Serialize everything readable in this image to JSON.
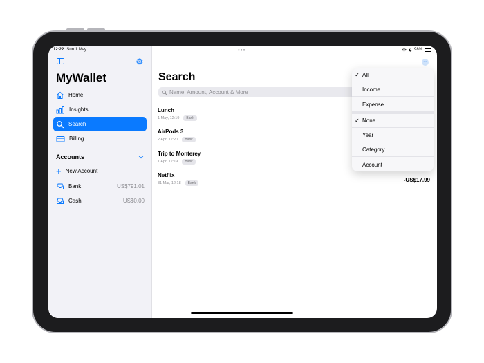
{
  "status": {
    "time": "12:22",
    "date": "Sun 1 May",
    "battery": "98%"
  },
  "multitask": "•••",
  "sidebar": {
    "app_title": "MyWallet",
    "nav": [
      {
        "label": "Home",
        "icon": "house-icon"
      },
      {
        "label": "Insights",
        "icon": "bar-chart-icon"
      },
      {
        "label": "Search",
        "icon": "search-icon",
        "active": true
      },
      {
        "label": "Billing",
        "icon": "credit-card-icon"
      }
    ],
    "accounts_header": "Accounts",
    "new_account_label": "New Account",
    "accounts": [
      {
        "name": "Bank",
        "balance": "US$791.01",
        "icon": "tray-icon"
      },
      {
        "name": "Cash",
        "balance": "US$0.00",
        "icon": "tray-icon"
      }
    ]
  },
  "main": {
    "title": "Search",
    "search_placeholder": "Name, Amount, Account & More",
    "transactions": [
      {
        "name": "Lunch",
        "date": "1 May, 12:19",
        "account": "Bank"
      },
      {
        "name": "AirPods 3",
        "date": "2 Apr, 12:20",
        "account": "Bank"
      },
      {
        "name": "Trip to Monterey",
        "date": "1 Apr, 12:19",
        "account": "Bank"
      },
      {
        "name": "Netflix",
        "date": "31 Mar, 12:18",
        "account": "Bank"
      }
    ],
    "visible_amount": "-US$17.99"
  },
  "menu": {
    "filter_items": [
      {
        "label": "All",
        "checked": true
      },
      {
        "label": "Income",
        "checked": false
      },
      {
        "label": "Expense",
        "checked": false
      }
    ],
    "group_items": [
      {
        "label": "None",
        "checked": true
      },
      {
        "label": "Year",
        "checked": false
      },
      {
        "label": "Category",
        "checked": false
      },
      {
        "label": "Account",
        "checked": false
      }
    ],
    "check_glyph": "✓"
  },
  "colors": {
    "accent": "#0a7aff",
    "sidebar_bg": "#f2f2f7"
  }
}
